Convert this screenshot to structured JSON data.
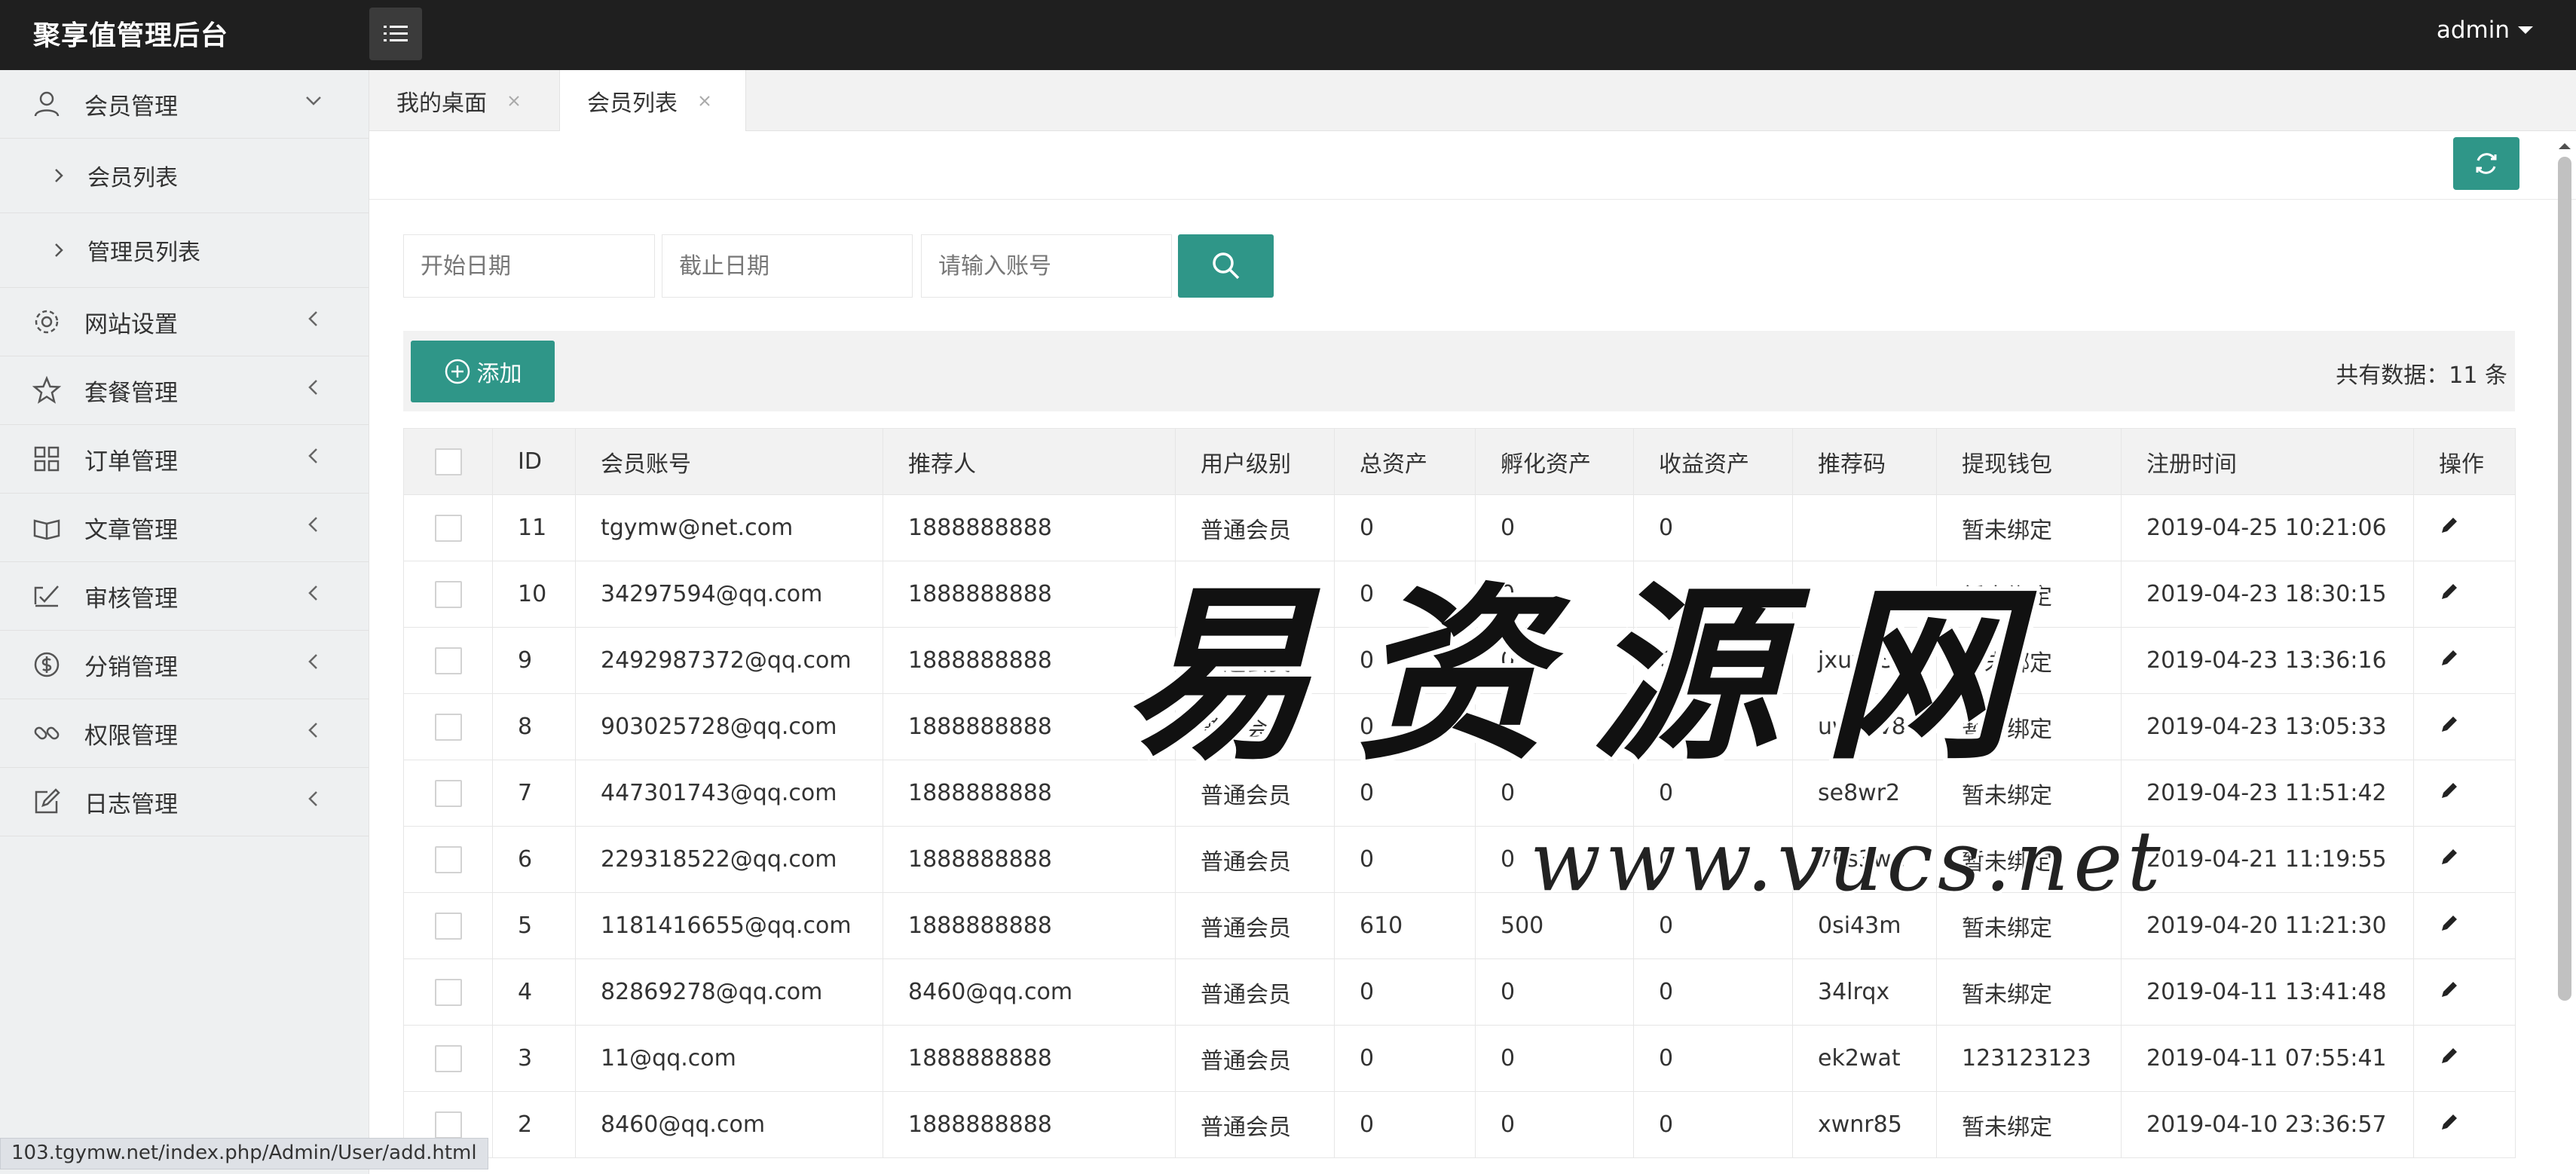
{
  "app": {
    "title": "聚享值管理后台",
    "user": "admin"
  },
  "sidebar": {
    "items": [
      {
        "label": "会员管理",
        "icon": "user-icon",
        "expanded": true,
        "children": [
          {
            "label": "会员列表"
          },
          {
            "label": "管理员列表"
          }
        ]
      },
      {
        "label": "网站设置",
        "icon": "gear-icon"
      },
      {
        "label": "套餐管理",
        "icon": "star-icon"
      },
      {
        "label": "订单管理",
        "icon": "grid-icon"
      },
      {
        "label": "文章管理",
        "icon": "book-icon"
      },
      {
        "label": "审核管理",
        "icon": "review-icon"
      },
      {
        "label": "分销管理",
        "icon": "dollar-icon"
      },
      {
        "label": "权限管理",
        "icon": "link-icon"
      },
      {
        "label": "日志管理",
        "icon": "edit-log-icon"
      }
    ]
  },
  "tabs": [
    {
      "label": "我的桌面",
      "active": false
    },
    {
      "label": "会员列表",
      "active": true
    }
  ],
  "filters": {
    "start_placeholder": "开始日期",
    "end_placeholder": "截止日期",
    "account_placeholder": "请输入账号"
  },
  "toolbar": {
    "add_label": "添加",
    "total_label": "共有数据：11 条"
  },
  "table": {
    "columns": [
      "ID",
      "会员账号",
      "推荐人",
      "用户级别",
      "总资产",
      "孵化资产",
      "收益资产",
      "推荐码",
      "提现钱包",
      "注册时间",
      "操作"
    ],
    "rows": [
      [
        "11",
        "tgymw@net.com",
        "1888888888",
        "普通会员",
        "0",
        "0",
        "0",
        "",
        "暂未绑定",
        "2019-04-25 10:21:06"
      ],
      [
        "10",
        "34297594@qq.com",
        "1888888888",
        "普通会员",
        "0",
        "0",
        "0",
        "",
        "暂未绑定",
        "2019-04-23 18:30:15"
      ],
      [
        "9",
        "2492987372@qq.com",
        "1888888888",
        "普通会员",
        "0",
        "0",
        "0",
        "jxuv43",
        "暂未绑定",
        "2019-04-23 13:36:16"
      ],
      [
        "8",
        "903025728@qq.com",
        "1888888888",
        "普通会员",
        "0",
        "0",
        "0",
        "uwkbv8",
        "暂未绑定",
        "2019-04-23 13:05:33"
      ],
      [
        "7",
        "447301743@qq.com",
        "1888888888",
        "普通会员",
        "0",
        "0",
        "0",
        "se8wr2",
        "暂未绑定",
        "2019-04-23 11:51:42"
      ],
      [
        "6",
        "229318522@qq.com",
        "1888888888",
        "普通会员",
        "0",
        "0",
        "0",
        "76s3we",
        "暂未绑定",
        "2019-04-21 11:19:55"
      ],
      [
        "5",
        "1181416655@qq.com",
        "1888888888",
        "普通会员",
        "610",
        "500",
        "0",
        "0si43m",
        "暂未绑定",
        "2019-04-20 11:21:30"
      ],
      [
        "4",
        "82869278@qq.com",
        "8460@qq.com",
        "普通会员",
        "0",
        "0",
        "0",
        "34lrqx",
        "暂未绑定",
        "2019-04-11 13:41:48"
      ],
      [
        "3",
        "11@qq.com",
        "1888888888",
        "普通会员",
        "0",
        "0",
        "0",
        "ek2wat",
        "123123123",
        "2019-04-11 07:55:41"
      ],
      [
        "2",
        "8460@qq.com",
        "1888888888",
        "普通会员",
        "0",
        "0",
        "0",
        "xwnr85",
        "暂未绑定",
        "2019-04-10 23:36:57"
      ]
    ]
  },
  "watermark": {
    "main": "易资源网",
    "sub": "www.vucs.net"
  },
  "status_url": "103.tgymw.net/index.php/Admin/User/add.html",
  "colors": {
    "accent": "#2f9688",
    "topbar": "#1f1f1f",
    "sidebar": "#eef0f1"
  }
}
